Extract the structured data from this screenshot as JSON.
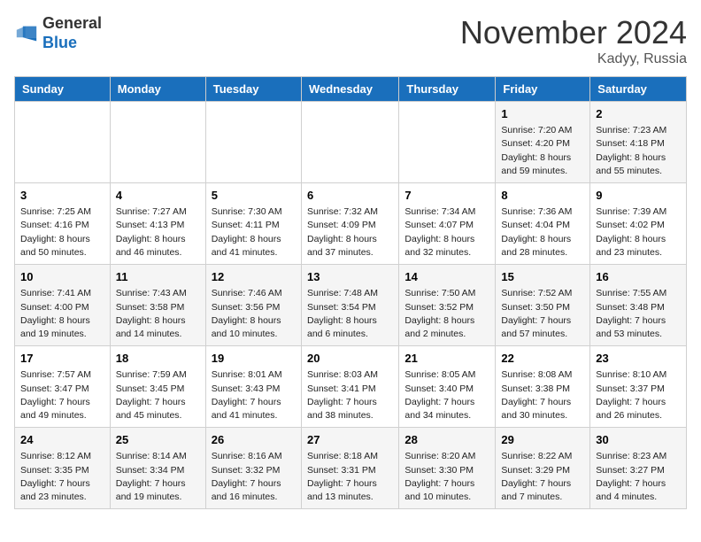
{
  "logo": {
    "general": "General",
    "blue": "Blue"
  },
  "header": {
    "month": "November 2024",
    "location": "Kadyy, Russia"
  },
  "weekdays": [
    "Sunday",
    "Monday",
    "Tuesday",
    "Wednesday",
    "Thursday",
    "Friday",
    "Saturday"
  ],
  "weeks": [
    [
      {
        "day": "",
        "info": ""
      },
      {
        "day": "",
        "info": ""
      },
      {
        "day": "",
        "info": ""
      },
      {
        "day": "",
        "info": ""
      },
      {
        "day": "",
        "info": ""
      },
      {
        "day": "1",
        "info": "Sunrise: 7:20 AM\nSunset: 4:20 PM\nDaylight: 8 hours and 59 minutes."
      },
      {
        "day": "2",
        "info": "Sunrise: 7:23 AM\nSunset: 4:18 PM\nDaylight: 8 hours and 55 minutes."
      }
    ],
    [
      {
        "day": "3",
        "info": "Sunrise: 7:25 AM\nSunset: 4:16 PM\nDaylight: 8 hours and 50 minutes."
      },
      {
        "day": "4",
        "info": "Sunrise: 7:27 AM\nSunset: 4:13 PM\nDaylight: 8 hours and 46 minutes."
      },
      {
        "day": "5",
        "info": "Sunrise: 7:30 AM\nSunset: 4:11 PM\nDaylight: 8 hours and 41 minutes."
      },
      {
        "day": "6",
        "info": "Sunrise: 7:32 AM\nSunset: 4:09 PM\nDaylight: 8 hours and 37 minutes."
      },
      {
        "day": "7",
        "info": "Sunrise: 7:34 AM\nSunset: 4:07 PM\nDaylight: 8 hours and 32 minutes."
      },
      {
        "day": "8",
        "info": "Sunrise: 7:36 AM\nSunset: 4:04 PM\nDaylight: 8 hours and 28 minutes."
      },
      {
        "day": "9",
        "info": "Sunrise: 7:39 AM\nSunset: 4:02 PM\nDaylight: 8 hours and 23 minutes."
      }
    ],
    [
      {
        "day": "10",
        "info": "Sunrise: 7:41 AM\nSunset: 4:00 PM\nDaylight: 8 hours and 19 minutes."
      },
      {
        "day": "11",
        "info": "Sunrise: 7:43 AM\nSunset: 3:58 PM\nDaylight: 8 hours and 14 minutes."
      },
      {
        "day": "12",
        "info": "Sunrise: 7:46 AM\nSunset: 3:56 PM\nDaylight: 8 hours and 10 minutes."
      },
      {
        "day": "13",
        "info": "Sunrise: 7:48 AM\nSunset: 3:54 PM\nDaylight: 8 hours and 6 minutes."
      },
      {
        "day": "14",
        "info": "Sunrise: 7:50 AM\nSunset: 3:52 PM\nDaylight: 8 hours and 2 minutes."
      },
      {
        "day": "15",
        "info": "Sunrise: 7:52 AM\nSunset: 3:50 PM\nDaylight: 7 hours and 57 minutes."
      },
      {
        "day": "16",
        "info": "Sunrise: 7:55 AM\nSunset: 3:48 PM\nDaylight: 7 hours and 53 minutes."
      }
    ],
    [
      {
        "day": "17",
        "info": "Sunrise: 7:57 AM\nSunset: 3:47 PM\nDaylight: 7 hours and 49 minutes."
      },
      {
        "day": "18",
        "info": "Sunrise: 7:59 AM\nSunset: 3:45 PM\nDaylight: 7 hours and 45 minutes."
      },
      {
        "day": "19",
        "info": "Sunrise: 8:01 AM\nSunset: 3:43 PM\nDaylight: 7 hours and 41 minutes."
      },
      {
        "day": "20",
        "info": "Sunrise: 8:03 AM\nSunset: 3:41 PM\nDaylight: 7 hours and 38 minutes."
      },
      {
        "day": "21",
        "info": "Sunrise: 8:05 AM\nSunset: 3:40 PM\nDaylight: 7 hours and 34 minutes."
      },
      {
        "day": "22",
        "info": "Sunrise: 8:08 AM\nSunset: 3:38 PM\nDaylight: 7 hours and 30 minutes."
      },
      {
        "day": "23",
        "info": "Sunrise: 8:10 AM\nSunset: 3:37 PM\nDaylight: 7 hours and 26 minutes."
      }
    ],
    [
      {
        "day": "24",
        "info": "Sunrise: 8:12 AM\nSunset: 3:35 PM\nDaylight: 7 hours and 23 minutes."
      },
      {
        "day": "25",
        "info": "Sunrise: 8:14 AM\nSunset: 3:34 PM\nDaylight: 7 hours and 19 minutes."
      },
      {
        "day": "26",
        "info": "Sunrise: 8:16 AM\nSunset: 3:32 PM\nDaylight: 7 hours and 16 minutes."
      },
      {
        "day": "27",
        "info": "Sunrise: 8:18 AM\nSunset: 3:31 PM\nDaylight: 7 hours and 13 minutes."
      },
      {
        "day": "28",
        "info": "Sunrise: 8:20 AM\nSunset: 3:30 PM\nDaylight: 7 hours and 10 minutes."
      },
      {
        "day": "29",
        "info": "Sunrise: 8:22 AM\nSunset: 3:29 PM\nDaylight: 7 hours and 7 minutes."
      },
      {
        "day": "30",
        "info": "Sunrise: 8:23 AM\nSunset: 3:27 PM\nDaylight: 7 hours and 4 minutes."
      }
    ]
  ]
}
